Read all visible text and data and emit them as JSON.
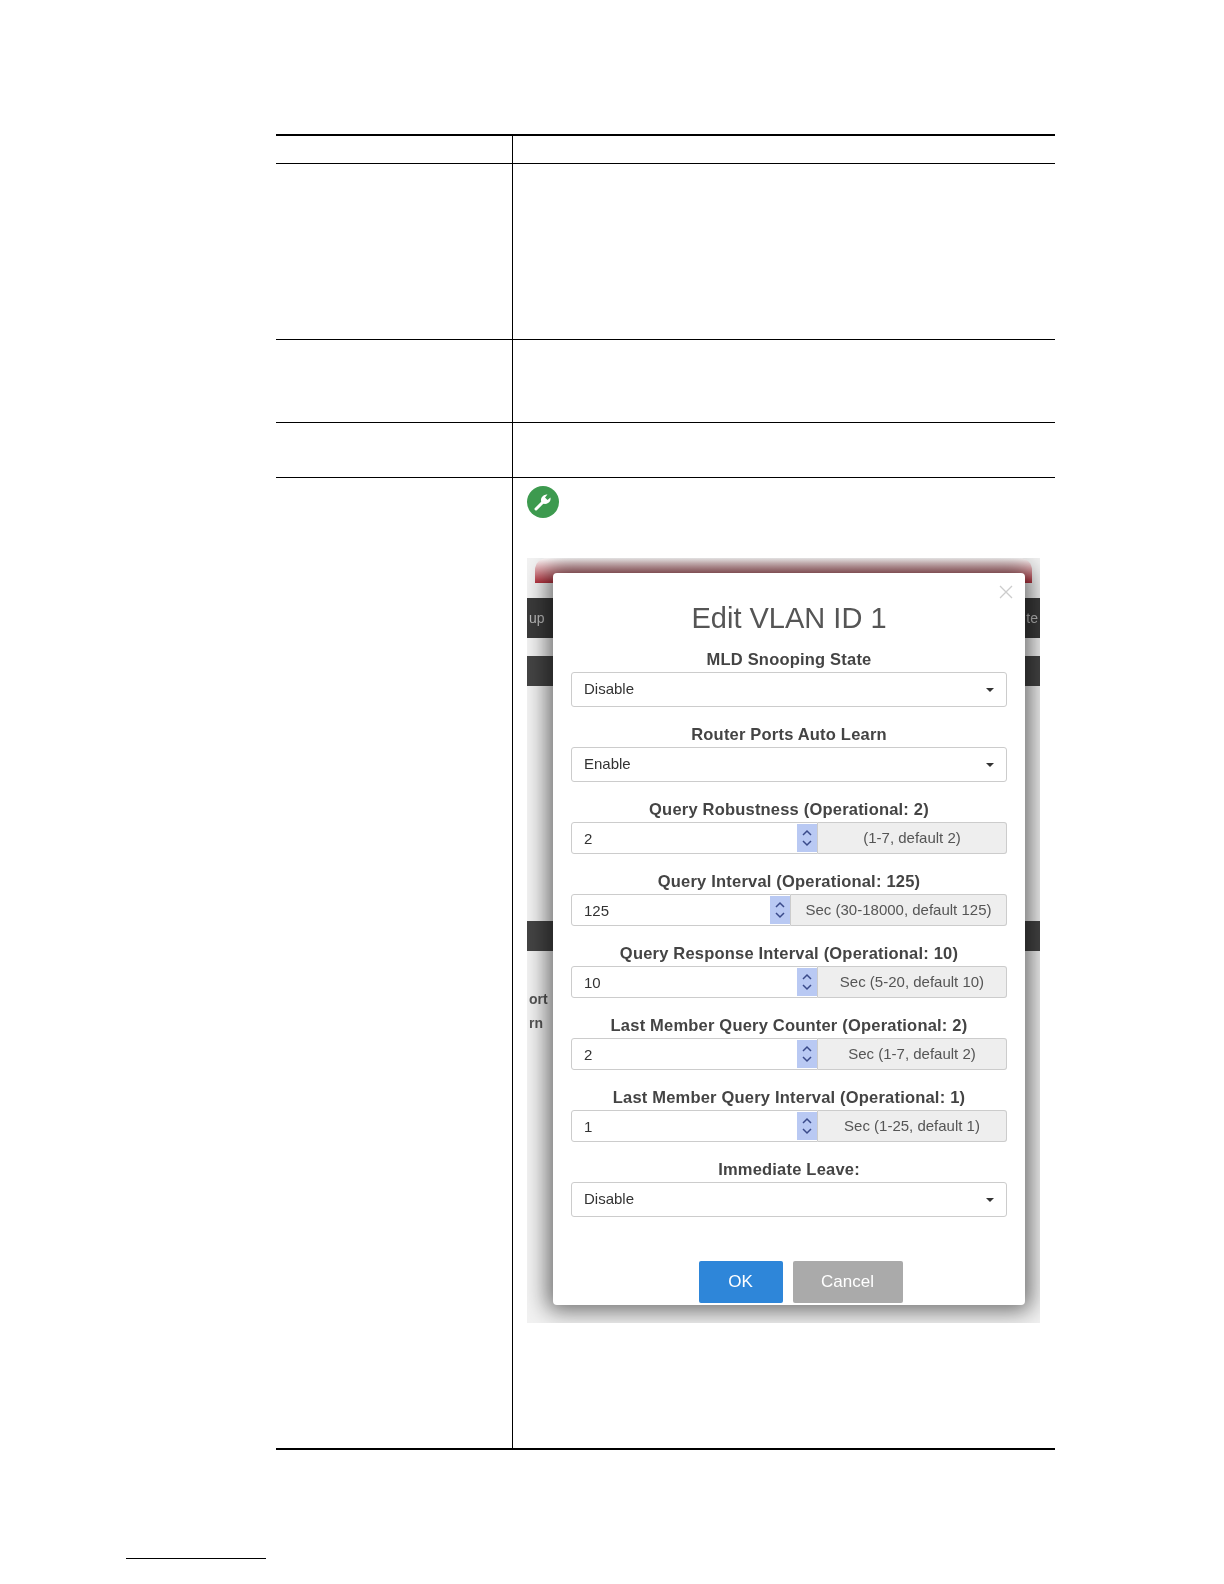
{
  "backdrop": {
    "bar_texts": [
      "up",
      "te"
    ],
    "column_texts": [
      "ort",
      "rn"
    ]
  },
  "dialog": {
    "title": "Edit VLAN ID 1",
    "fields": [
      {
        "kind": "select",
        "label": "MLD Snooping State",
        "value": "Disable"
      },
      {
        "kind": "select",
        "label": "Router Ports Auto Learn",
        "value": "Enable"
      },
      {
        "kind": "spinner",
        "label": "Query Robustness (Operational: 2)",
        "value": "2",
        "hint": "(1-7, default 2)"
      },
      {
        "kind": "spinner",
        "label": "Query Interval (Operational: 125)",
        "value": "125",
        "hint": "Sec (30-18000, default 125)"
      },
      {
        "kind": "spinner",
        "label": "Query Response Interval (Operational: 10)",
        "value": "10",
        "hint": "Sec (5-20, default 10)"
      },
      {
        "kind": "spinner",
        "label": "Last Member Query Counter (Operational: 2)",
        "value": "2",
        "hint": "Sec (1-7, default 2)"
      },
      {
        "kind": "spinner",
        "label": "Last Member Query Interval (Operational: 1)",
        "value": "1",
        "hint": "Sec (1-25, default 1)"
      },
      {
        "kind": "select",
        "label": "Immediate Leave:",
        "value": "Disable"
      }
    ],
    "buttons": [
      {
        "label": "OK",
        "kind": "primary"
      },
      {
        "label": "Cancel",
        "kind": "secondary"
      }
    ]
  }
}
